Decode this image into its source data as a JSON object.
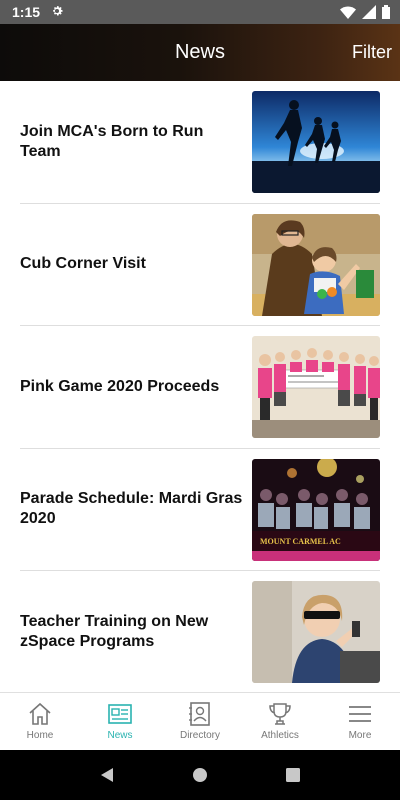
{
  "status_bar": {
    "time": "1:15",
    "settings_icon": "gear-icon"
  },
  "header": {
    "title": "News",
    "filter_label": "Filter",
    "gradient_start": "#0d0b0a",
    "gradient_end": "#5a3315"
  },
  "news_items": [
    {
      "title": "Join MCA's Born to Run Team",
      "image": "runners-silhouette"
    },
    {
      "title": "Cub Corner Visit",
      "image": "child-with-toy"
    },
    {
      "title": "Pink Game 2020 Proceeds",
      "image": "check-presentation"
    },
    {
      "title": " Parade Schedule: Mardi Gras 2020",
      "image": "mardi-gras-float"
    },
    {
      "title": "Teacher Training on New zSpace Programs",
      "image": "teacher-3d-glasses"
    }
  ],
  "bottom_nav": [
    {
      "label": "Home",
      "icon": "home-icon"
    },
    {
      "label": "News",
      "icon": "news-icon",
      "active": true
    },
    {
      "label": "Directory",
      "icon": "directory-icon"
    },
    {
      "label": "Athletics",
      "icon": "trophy-icon"
    },
    {
      "label": "More",
      "icon": "menu-icon"
    }
  ],
  "colors": {
    "accent": "#2ab3b0",
    "nav_inactive": "#777777"
  }
}
